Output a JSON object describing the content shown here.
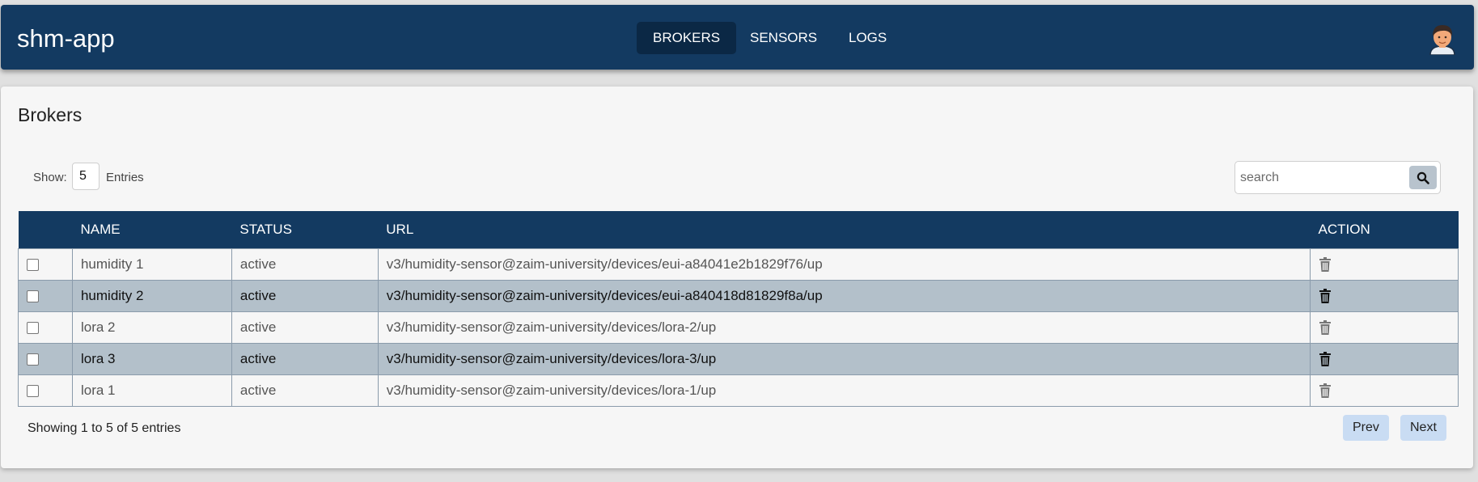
{
  "header": {
    "brand": "shm-app",
    "nav": [
      {
        "label": "BROKERS",
        "active": true
      },
      {
        "label": "SENSORS",
        "active": false
      },
      {
        "label": "LOGS",
        "active": false
      }
    ],
    "avatar_icon": "user-avatar-icon"
  },
  "page": {
    "title": "Brokers",
    "show_label": "Show:",
    "entries_value": "5",
    "entries_label": "Entries",
    "search_placeholder": "search",
    "search_icon": "search-icon"
  },
  "table": {
    "columns": [
      "",
      "NAME",
      "STATUS",
      "URL",
      "ACTION"
    ],
    "rows": [
      {
        "name": "humidity 1",
        "status": "active",
        "url": "v3/humidity-sensor@zaim-university/devices/eui-a84041e2b1829f76/up"
      },
      {
        "name": "humidity 2",
        "status": "active",
        "url": "v3/humidity-sensor@zaim-university/devices/eui-a840418d81829f8a/up"
      },
      {
        "name": "lora 2",
        "status": "active",
        "url": "v3/humidity-sensor@zaim-university/devices/lora-2/up"
      },
      {
        "name": "lora 3",
        "status": "active",
        "url": "v3/humidity-sensor@zaim-university/devices/lora-3/up"
      },
      {
        "name": "lora 1",
        "status": "active",
        "url": "v3/humidity-sensor@zaim-university/devices/lora-1/up"
      }
    ],
    "row_action_icon": "trash-icon"
  },
  "footer": {
    "info": "Showing 1 to 5 of 5 entries",
    "prev": "Prev",
    "next": "Next"
  },
  "colors": {
    "primary": "#133a61",
    "active_nav": "#0b2845",
    "row_alt": "#b3c0ca",
    "pager_button": "#c9dcf3"
  }
}
